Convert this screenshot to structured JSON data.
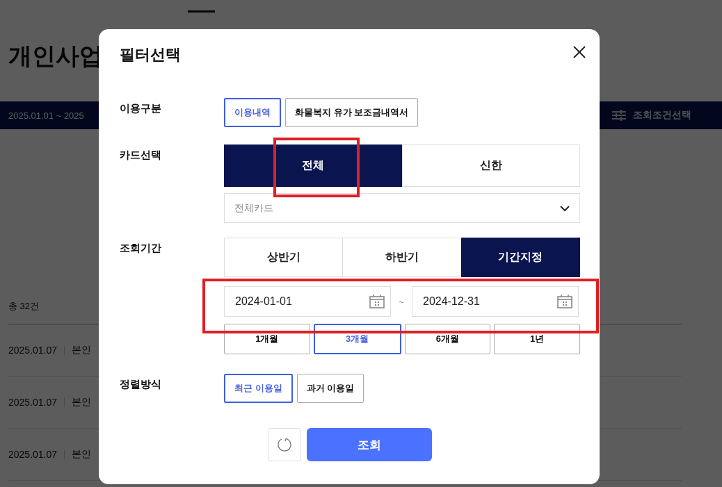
{
  "page": {
    "title": "개인사업",
    "period": "2025.01.01 ~ 2025",
    "filter_button": "조회조건선택",
    "total": "총 32건",
    "rows": [
      {
        "date": "2025.01.07",
        "owner": "본인"
      },
      {
        "date": "2025.01.07",
        "owner": "본인"
      },
      {
        "date": "2025.01.07",
        "owner": "본인"
      }
    ]
  },
  "dialog": {
    "title": "필터선택",
    "usage_type": {
      "label": "이용구분",
      "options": [
        {
          "label": "이용내역",
          "selected": true
        },
        {
          "label": "화물복지 유가 보조금내역서",
          "selected": false
        }
      ]
    },
    "card_select": {
      "label": "카드선택",
      "options": [
        {
          "label": "전체",
          "selected": true
        },
        {
          "label": "신한",
          "selected": false
        }
      ],
      "dropdown": {
        "value": "전체카드"
      }
    },
    "period": {
      "label": "조회기간",
      "options": [
        {
          "label": "상반기",
          "selected": false
        },
        {
          "label": "하반기",
          "selected": false
        },
        {
          "label": "기간지정",
          "selected": true
        }
      ],
      "start_date": "2024-01-01",
      "separator": "~",
      "end_date": "2024-12-31",
      "quick_ranges": [
        {
          "label": "1개월",
          "selected": false
        },
        {
          "label": "3개월",
          "selected": true
        },
        {
          "label": "6개월",
          "selected": false
        },
        {
          "label": "1년",
          "selected": false
        }
      ]
    },
    "sort": {
      "label": "정렬방식",
      "options": [
        {
          "label": "최근 이용일",
          "selected": true
        },
        {
          "label": "과거 이용일",
          "selected": false
        }
      ]
    },
    "search_button": "조회"
  }
}
